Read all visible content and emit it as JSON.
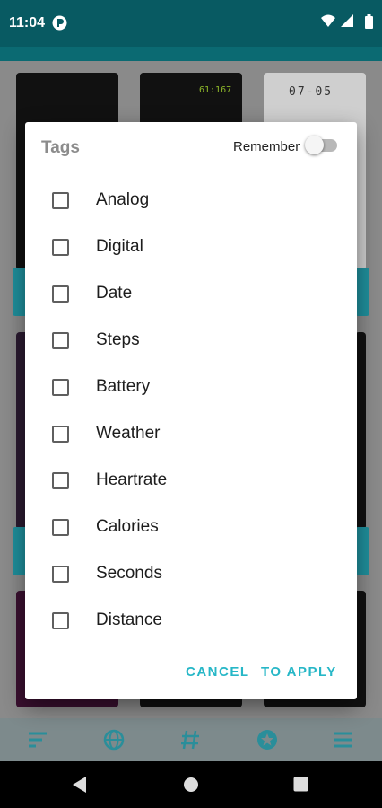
{
  "status_bar": {
    "time": "11:04",
    "icons": [
      "app-notification-icon",
      "wifi-icon",
      "signal-icon",
      "battery-icon"
    ]
  },
  "background": {
    "card_text": {
      "watch_counter": "61:167",
      "watch_date": "07-05"
    }
  },
  "dialog": {
    "title": "Tags",
    "remember_label": "Remember",
    "remember_on": false,
    "tags": [
      {
        "label": "Analog",
        "checked": false
      },
      {
        "label": "Digital",
        "checked": false
      },
      {
        "label": "Date",
        "checked": false
      },
      {
        "label": "Steps",
        "checked": false
      },
      {
        "label": "Battery",
        "checked": false
      },
      {
        "label": "Weather",
        "checked": false
      },
      {
        "label": "Heartrate",
        "checked": false
      },
      {
        "label": "Calories",
        "checked": false
      },
      {
        "label": "Seconds",
        "checked": false
      },
      {
        "label": "Distance",
        "checked": false
      }
    ],
    "cancel_label": "CANCEL",
    "apply_label": "TO APPLY"
  },
  "bottom_nav": {
    "items": [
      "sort-icon",
      "globe-icon",
      "hash-icon",
      "star-icon",
      "menu-icon"
    ]
  },
  "colors": {
    "accent": "#27b7c7",
    "status_bar": "#085a62"
  }
}
